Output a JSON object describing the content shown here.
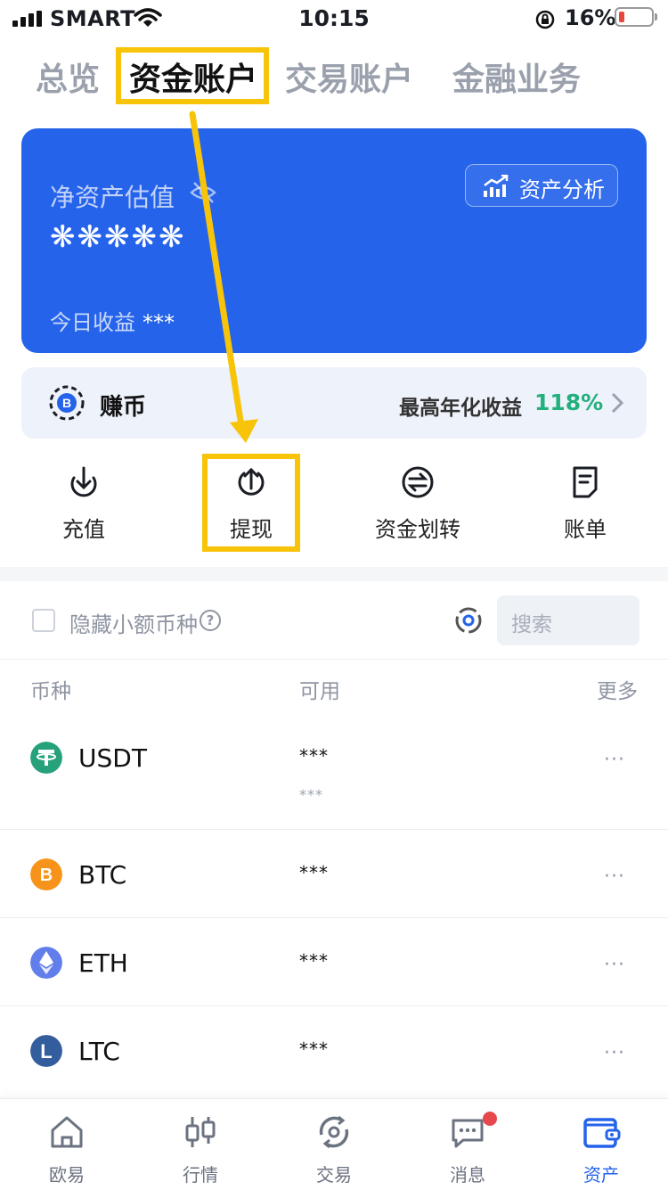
{
  "status_bar": {
    "carrier": "SMART",
    "time": "10:15",
    "battery": "16%"
  },
  "top_tabs": [
    {
      "label": "总览"
    },
    {
      "label": "资金账户"
    },
    {
      "label": "交易账户"
    },
    {
      "label": "金融业务"
    }
  ],
  "card": {
    "label": "净资产估值",
    "value": "❋❋❋❋❋",
    "today_label": "今日收益",
    "today_value": "***",
    "analysis_button": "资产分析"
  },
  "earn": {
    "title": "赚币",
    "rate_label": "最高年化收益",
    "rate": "118%"
  },
  "quick_actions": [
    {
      "label": "充值",
      "icon": "deposit-icon"
    },
    {
      "label": "提现",
      "icon": "withdraw-icon"
    },
    {
      "label": "资金划转",
      "icon": "transfer-icon"
    },
    {
      "label": "账单",
      "icon": "bill-icon"
    }
  ],
  "filter": {
    "hide_small_label": "隐藏小额币种",
    "search_placeholder": "搜索"
  },
  "table": {
    "headers": {
      "coin": "币种",
      "available": "可用",
      "more": "更多"
    },
    "rows": [
      {
        "symbol": "USDT",
        "available": "***",
        "sub": "***",
        "more": "···",
        "color": "#26a17b"
      },
      {
        "symbol": "BTC",
        "available": "***",
        "more": "···",
        "color": "#f7931a"
      },
      {
        "symbol": "ETH",
        "available": "***",
        "more": "···",
        "color": "#627eea"
      },
      {
        "symbol": "LTC",
        "available": "***",
        "more": "···",
        "color": "#345d9d"
      }
    ]
  },
  "bottom_nav": [
    {
      "label": "欧易",
      "icon": "home-icon"
    },
    {
      "label": "行情",
      "icon": "candlestick-icon"
    },
    {
      "label": "交易",
      "icon": "trade-icon"
    },
    {
      "label": "消息",
      "icon": "message-icon"
    },
    {
      "label": "资产",
      "icon": "wallet-icon",
      "active": true
    }
  ],
  "colors": {
    "accent": "#2563ea",
    "highlight": "#f7c40a",
    "positive": "#23b07d"
  }
}
